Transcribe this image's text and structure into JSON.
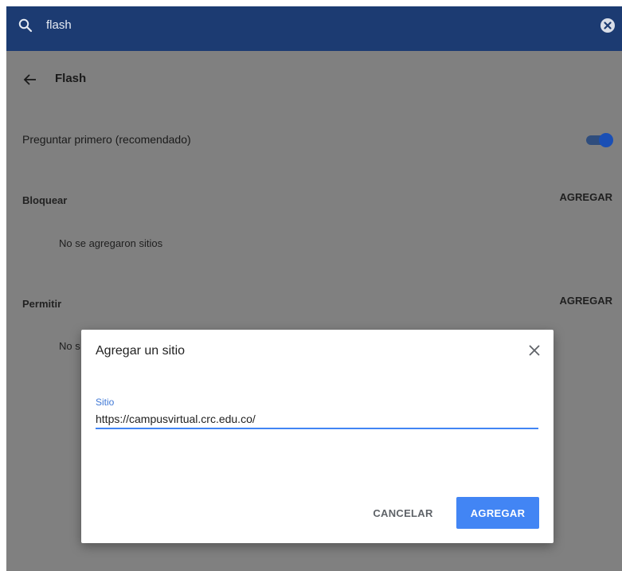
{
  "search": {
    "query": "flash"
  },
  "page": {
    "title": "Flash",
    "ask_first_label": "Preguntar primero (recomendado)",
    "ask_first_enabled": true,
    "block": {
      "label": "Bloquear",
      "action": "AGREGAR",
      "empty_text": "No se agregaron sitios"
    },
    "allow": {
      "label": "Permitir",
      "action": "AGREGAR",
      "empty_text": "No s"
    }
  },
  "dialog": {
    "title": "Agregar un sitio",
    "field_label": "Sitio",
    "field_value": "https://campusvirtual.crc.edu.co/",
    "cancel_label": "CANCELAR",
    "add_label": "AGREGAR"
  },
  "colors": {
    "header": "#1c3b72",
    "overlay": "#808080",
    "accent": "#4285f4",
    "toggle_on": "#1a4fb5"
  },
  "icons": {
    "search": "search-icon",
    "clear": "clear-icon",
    "back": "back-arrow-icon",
    "close": "close-icon"
  }
}
